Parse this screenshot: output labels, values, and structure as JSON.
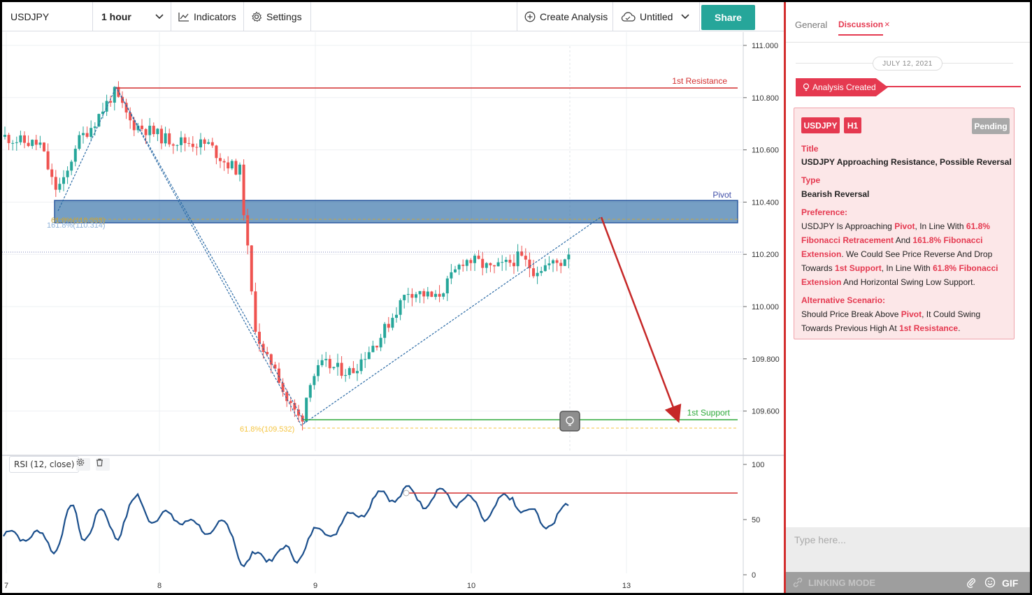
{
  "toolbar": {
    "symbol": "USDJPY",
    "interval": "1 hour",
    "indicators_label": "Indicators",
    "settings_label": "Settings",
    "create_analysis_label": "Create Analysis",
    "layout_name": "Untitled",
    "share_label": "Share"
  },
  "chart": {
    "price_ticks": [
      "111.000",
      "110.800",
      "110.600",
      "110.400",
      "110.200",
      "110.000",
      "109.800",
      "109.600"
    ],
    "time_ticks": [
      "7",
      "8",
      "9",
      "10",
      "13"
    ],
    "rsi_ticks": [
      "100",
      "50",
      "0"
    ],
    "rsi_legend": "RSI (12, close)",
    "labels": {
      "resistance": "1st Resistance",
      "pivot": "Pivot",
      "support": "1st Support",
      "fib_upper_a": "61.8%(110.333)",
      "fib_upper_b": "161.8%(110.314)",
      "fib_lower": "61.8%(109.532)"
    },
    "colors": {
      "bull": "#26a69a",
      "bear": "#ef5350",
      "resistance": "#d32f2f",
      "support": "#2eaa3a",
      "pivot_zone": "#2d6ca4",
      "rsi_line": "#1b4f8c",
      "fib": "#f5c542"
    }
  },
  "chart_data": {
    "type": "candlestick",
    "y_range": [
      109.45,
      111.0
    ],
    "levels": {
      "resistance": 110.835,
      "pivot_top": 110.405,
      "pivot_bottom": 110.32,
      "support": 109.565,
      "fib_lower": 109.532
    },
    "rsi_range": [
      0,
      100
    ]
  },
  "panel": {
    "tabs": {
      "general": "General",
      "discussion": "Discussion",
      "close": "×"
    },
    "date": "JULY 12, 2021",
    "created_tag": "Analysis Created",
    "card": {
      "symbol": "USDJPY",
      "timeframe": "H1",
      "status": "Pending",
      "title_label": "Title",
      "title": "USDJPY Approaching Resistance, Possible Reversal",
      "type_label": "Type",
      "type": "Bearish Reversal",
      "preference_label": "Preference:",
      "pref": {
        "t1": "USDJPY Is Approaching ",
        "h1": "Pivot",
        "t2": ", In Line With ",
        "h2": "61.8% Fibonacci Retracement",
        "t3": " And ",
        "h3": "161.8% Fibonacci Extension",
        "t4": ". We Could See Price Reverse And Drop Towards ",
        "h4": "1st Support",
        "t5": ", In Line With ",
        "h5": "61.8% Fibonacci Extension",
        "t6": " And Horizontal Swing Low Support."
      },
      "alt_label": "Alternative Scenario:",
      "alt": {
        "t1": "Should Price Break Above ",
        "h1": "Pivot",
        "t2": ", It Could Swing Towards Previous High At ",
        "h2": "1st Resistance",
        "t3": "."
      }
    },
    "chat_placeholder": "Type here...",
    "linking_mode": "LINKING MODE",
    "gif_label": "GIF"
  }
}
